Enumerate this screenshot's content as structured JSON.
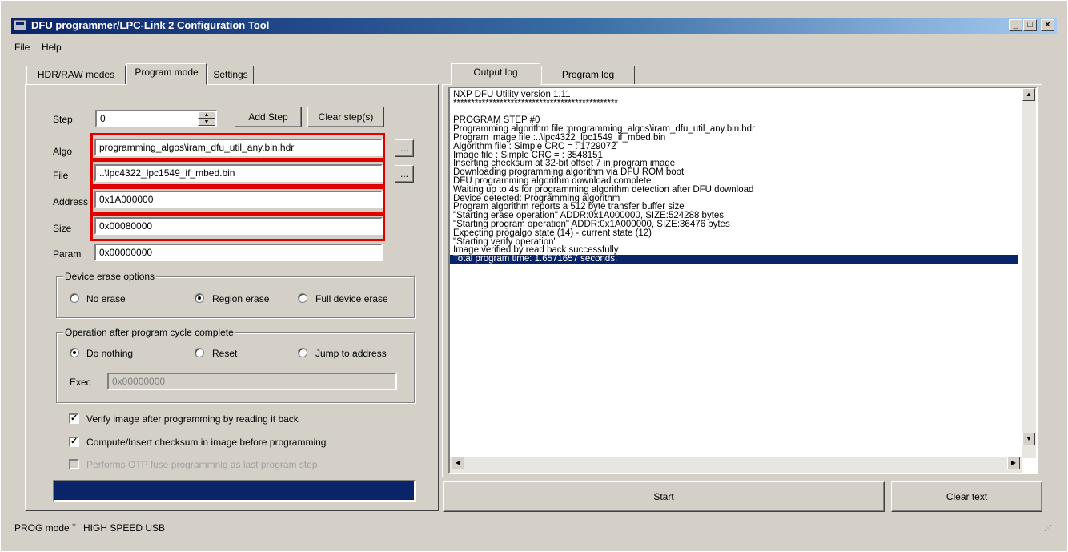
{
  "window": {
    "title": "DFU programmer/LPC-Link 2 Configuration Tool"
  },
  "menu": [
    "File",
    "Help"
  ],
  "left_tabs": [
    "HDR/RAW modes",
    "Program mode",
    "Settings"
  ],
  "right_tabs": [
    "Output log",
    "Program log"
  ],
  "form": {
    "step_label": "Step",
    "step_value": "0",
    "add_step": "Add Step",
    "clear_steps": "Clear step(s)",
    "algo_label": "Algo",
    "algo_value": "programming_algos\\iram_dfu_util_any.bin.hdr",
    "file_label": "File",
    "file_value": "..\\lpc4322_lpc1549_if_mbed.bin",
    "browse": "...",
    "address_label": "Address",
    "address_value": "0x1A000000",
    "size_label": "Size",
    "size_value": "0x00080000",
    "param_label": "Param",
    "param_value": "0x00000000"
  },
  "erase_group": {
    "title": "Device erase options",
    "options": [
      "No erase",
      "Region erase",
      "Full device erase"
    ],
    "selected": "Region erase"
  },
  "after_group": {
    "title": "Operation after program cycle complete",
    "options": [
      "Do nothing",
      "Reset",
      "Jump to address"
    ],
    "selected": "Do nothing",
    "exec_label": "Exec",
    "exec_value": "0x00000000"
  },
  "checks": [
    {
      "label": "Verify image after programming by reading it back",
      "checked": true,
      "enabled": true
    },
    {
      "label": "Compute/Insert checksum in image before programming",
      "checked": true,
      "enabled": true
    },
    {
      "label": "Performs OTP fuse programmnig as last program step",
      "checked": false,
      "enabled": false
    }
  ],
  "progress": {
    "value": 1.0,
    "color": "#0a246a"
  },
  "log_lines": [
    "NXP DFU Utility version 1.11",
    "**********************************************",
    "",
    "PROGRAM STEP #0",
    "Programming algorithm file :programming_algos\\iram_dfu_util_any.bin.hdr",
    "Program image file :..\\lpc4322_lpc1549_if_mbed.bin",
    "Algorithm file : Simple CRC = : 1729072",
    "Image file : Simple CRC = : 3548151",
    "Inserting checksum at 32-bit offset 7 in program image",
    "Downloading programming algorithm via DFU ROM boot",
    "DFU programming algorithm download complete",
    "Waiting up to 4s for programming algorithm detection after DFU download",
    "Device detected: Programming algorithm",
    "Program algorithm reports a 512 byte transfer buffer size",
    "\"Starting erase operation\" ADDR:0x1A000000, SIZE:524288 bytes",
    "\"Starting program operation\" ADDR:0x1A000000, SIZE:36476 bytes",
    "Expecting progalgo state (14) - current state (12)",
    "\"Starting verify operation\"",
    "Image verified by read back successfully",
    "Total program time:  1.6571657 seconds."
  ],
  "highlighted_line_color": "#0a246a",
  "buttons": {
    "start": "Start",
    "clear_text": "Clear text"
  },
  "status": {
    "mode": "PROG mode",
    "speed": "HIGH SPEED USB"
  }
}
